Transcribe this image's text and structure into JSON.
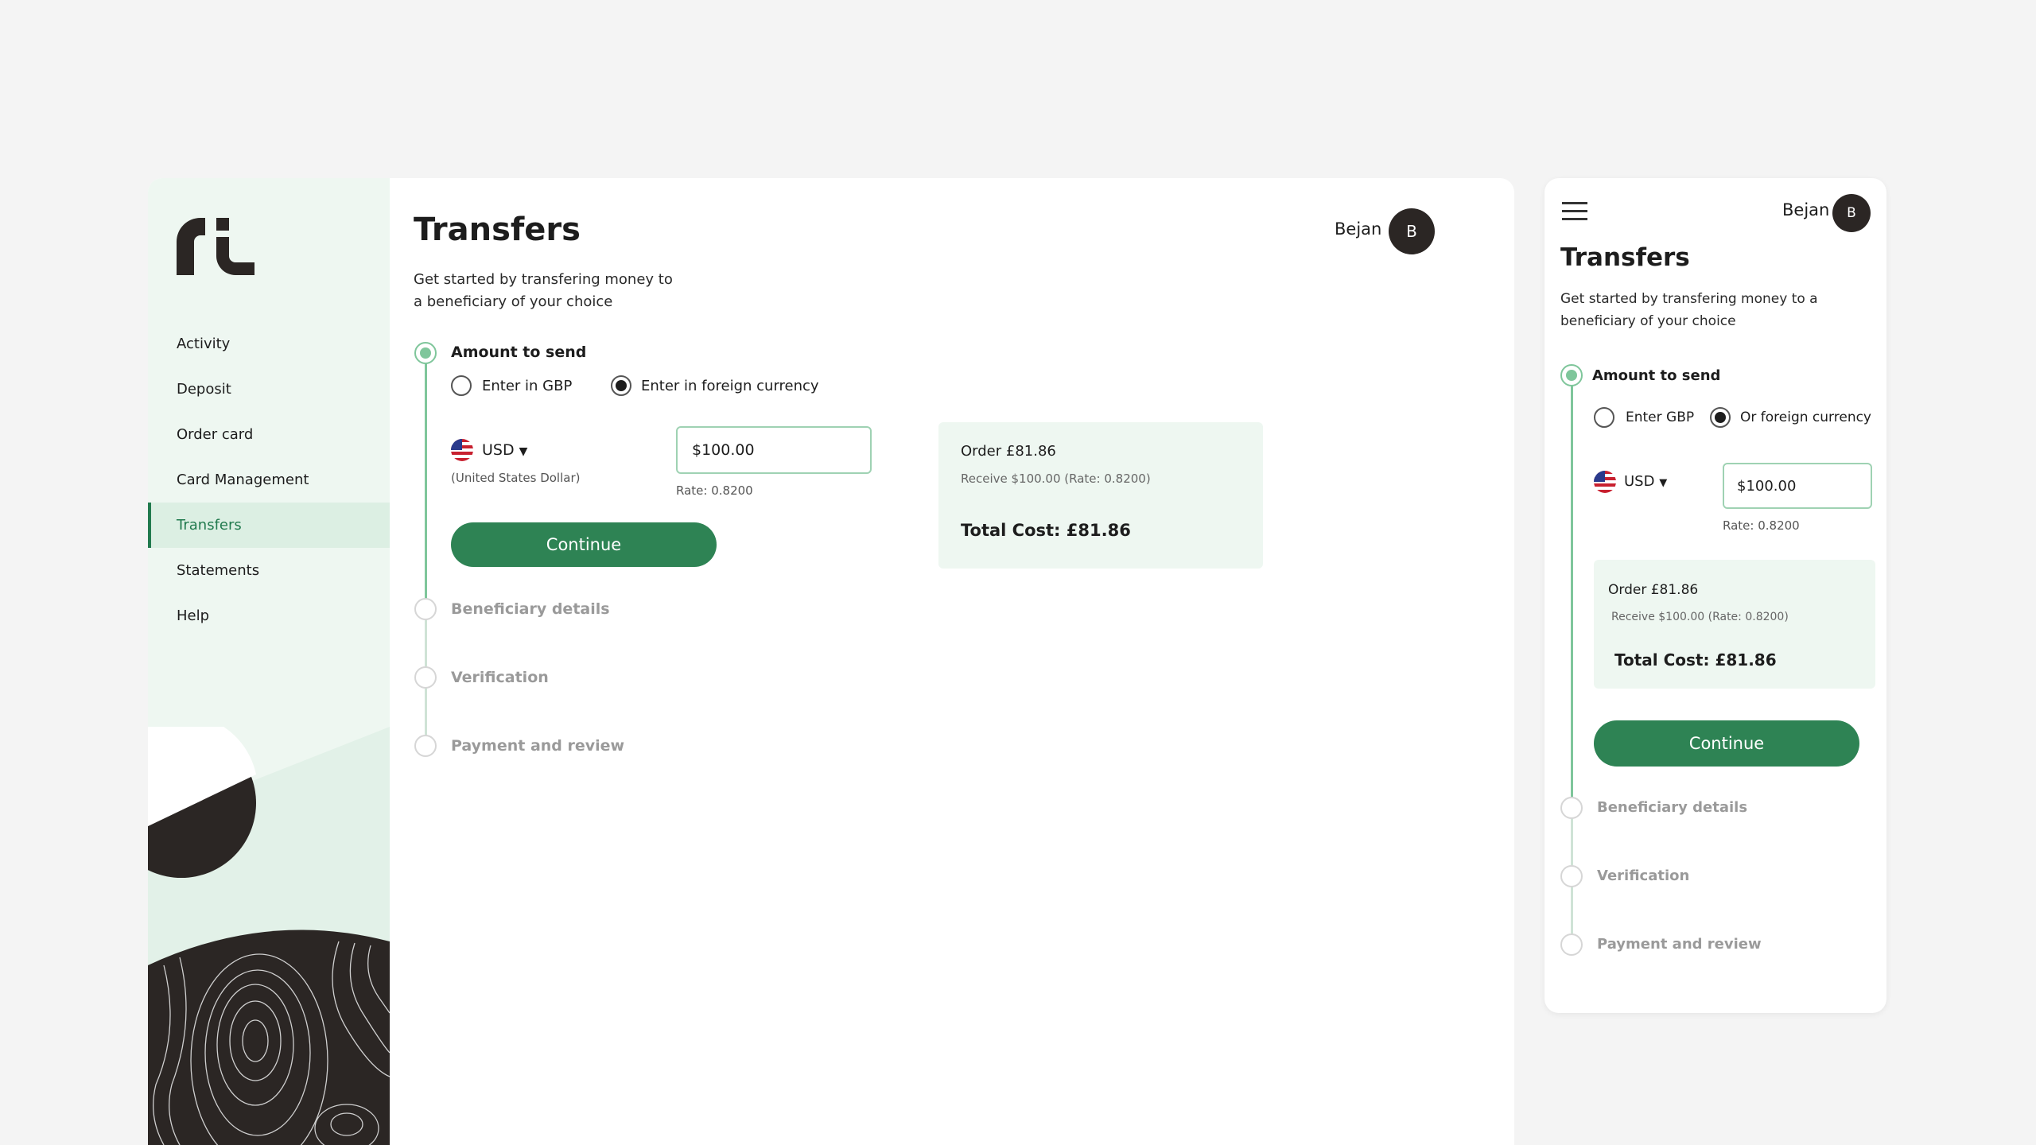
{
  "user": {
    "name": "Bejan",
    "initial": "B"
  },
  "nav": {
    "items": [
      {
        "label": "Activity"
      },
      {
        "label": "Deposit"
      },
      {
        "label": "Order card"
      },
      {
        "label": "Card Management"
      },
      {
        "label": "Transfers",
        "active": true
      },
      {
        "label": "Statements"
      },
      {
        "label": "Help"
      }
    ]
  },
  "page": {
    "title": "Transfers",
    "subtitle": "Get started by transfering money to a beneficiary of your choice"
  },
  "steps": [
    {
      "label": "Amount to send",
      "active": true
    },
    {
      "label": "Beneficiary details"
    },
    {
      "label": "Verification"
    },
    {
      "label": "Payment and review"
    }
  ],
  "amount": {
    "option_gbp": "Enter in GBP",
    "option_foreign": "Enter in foreign currency",
    "mobile_option_gbp": "Enter GBP",
    "mobile_option_foreign": "Or foreign currency",
    "selected": "foreign",
    "currency_code": "USD",
    "currency_name": "(United States Dollar)",
    "value": "$100.00",
    "rate": "Rate: 0.8200",
    "continue_label": "Continue"
  },
  "summary": {
    "order": "Order £81.86",
    "receive": "Receive $100.00 (Rate: 0.8200)",
    "total": "Total Cost: £81.86"
  },
  "colors": {
    "brand_green": "#2e8354",
    "light_green": "#eef7f1",
    "step_green": "#7fc69b",
    "dark": "#2b2624"
  },
  "icons": [
    "logo-mark",
    "us-flag-icon",
    "caret-down-icon",
    "hamburger-icon"
  ]
}
